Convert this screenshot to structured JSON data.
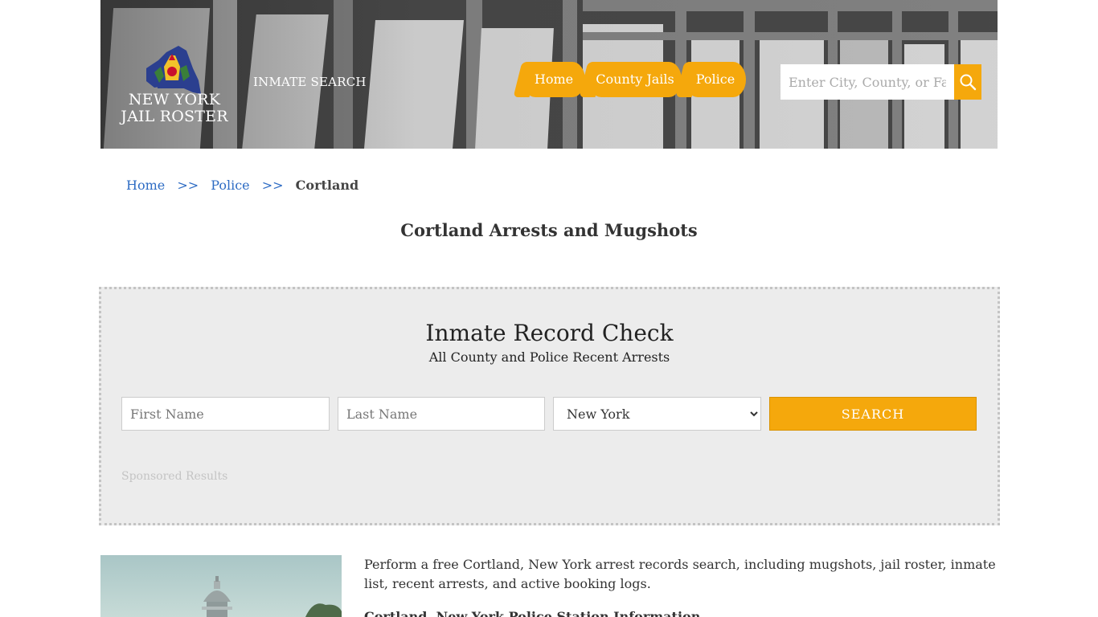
{
  "header": {
    "logo_line1": "NEW YORK",
    "logo_line2": "JAIL ROSTER",
    "inmate_search_label": "INMATE SEARCH",
    "nav": [
      {
        "label": "Home"
      },
      {
        "label": "County Jails"
      },
      {
        "label": "Police"
      }
    ],
    "search_placeholder": "Enter City, County, or Facility",
    "search_icon": "search-icon",
    "accent_color": "#f5a80c"
  },
  "breadcrumb": {
    "home": "Home",
    "sep1": ">>",
    "police": "Police",
    "sep2": ">>",
    "current": "Cortland"
  },
  "page_title": "Cortland Arrests and Mugshots",
  "record_check": {
    "title": "Inmate Record Check",
    "subtitle": "All County and Police Recent Arrests",
    "first_name_placeholder": "First Name",
    "last_name_placeholder": "Last Name",
    "state_selected": "New York",
    "search_button": "SEARCH",
    "sponsored": "Sponsored Results"
  },
  "content": {
    "intro": "Perform a free Cortland, New York arrest records search, including mugshots, jail roster, inmate list, recent arrests, and active booking logs.",
    "info_heading": "Cortland, New York Police Station Information"
  }
}
